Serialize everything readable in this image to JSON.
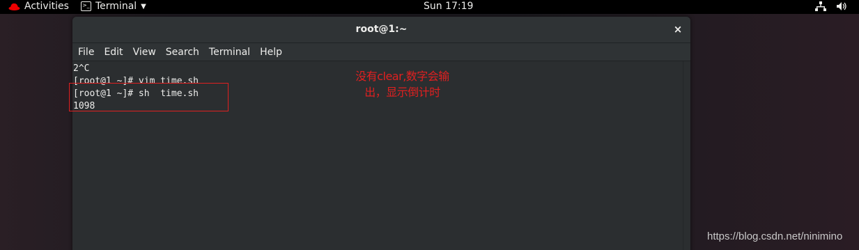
{
  "topbar": {
    "activities_label": "Activities",
    "app_menu_label": "Terminal",
    "clock": "Sun 17:19",
    "icons": [
      "redhat-icon",
      "terminal-app-icon",
      "network-icon",
      "volume-icon"
    ]
  },
  "window": {
    "title": "root@1:~",
    "close_symbol": "×",
    "menu": [
      "File",
      "Edit",
      "View",
      "Search",
      "Terminal",
      "Help"
    ]
  },
  "terminal": {
    "lines": [
      "2^C",
      "[root@1 ~]# vim time.sh",
      "[root@1 ~]# sh  time.sh",
      "1098"
    ]
  },
  "annotation": {
    "text_line1": "没有clear,数字会输",
    "text_line2": "出，显示倒计时",
    "color": "#e02020"
  },
  "watermark": "https://blog.csdn.net/ninimino"
}
